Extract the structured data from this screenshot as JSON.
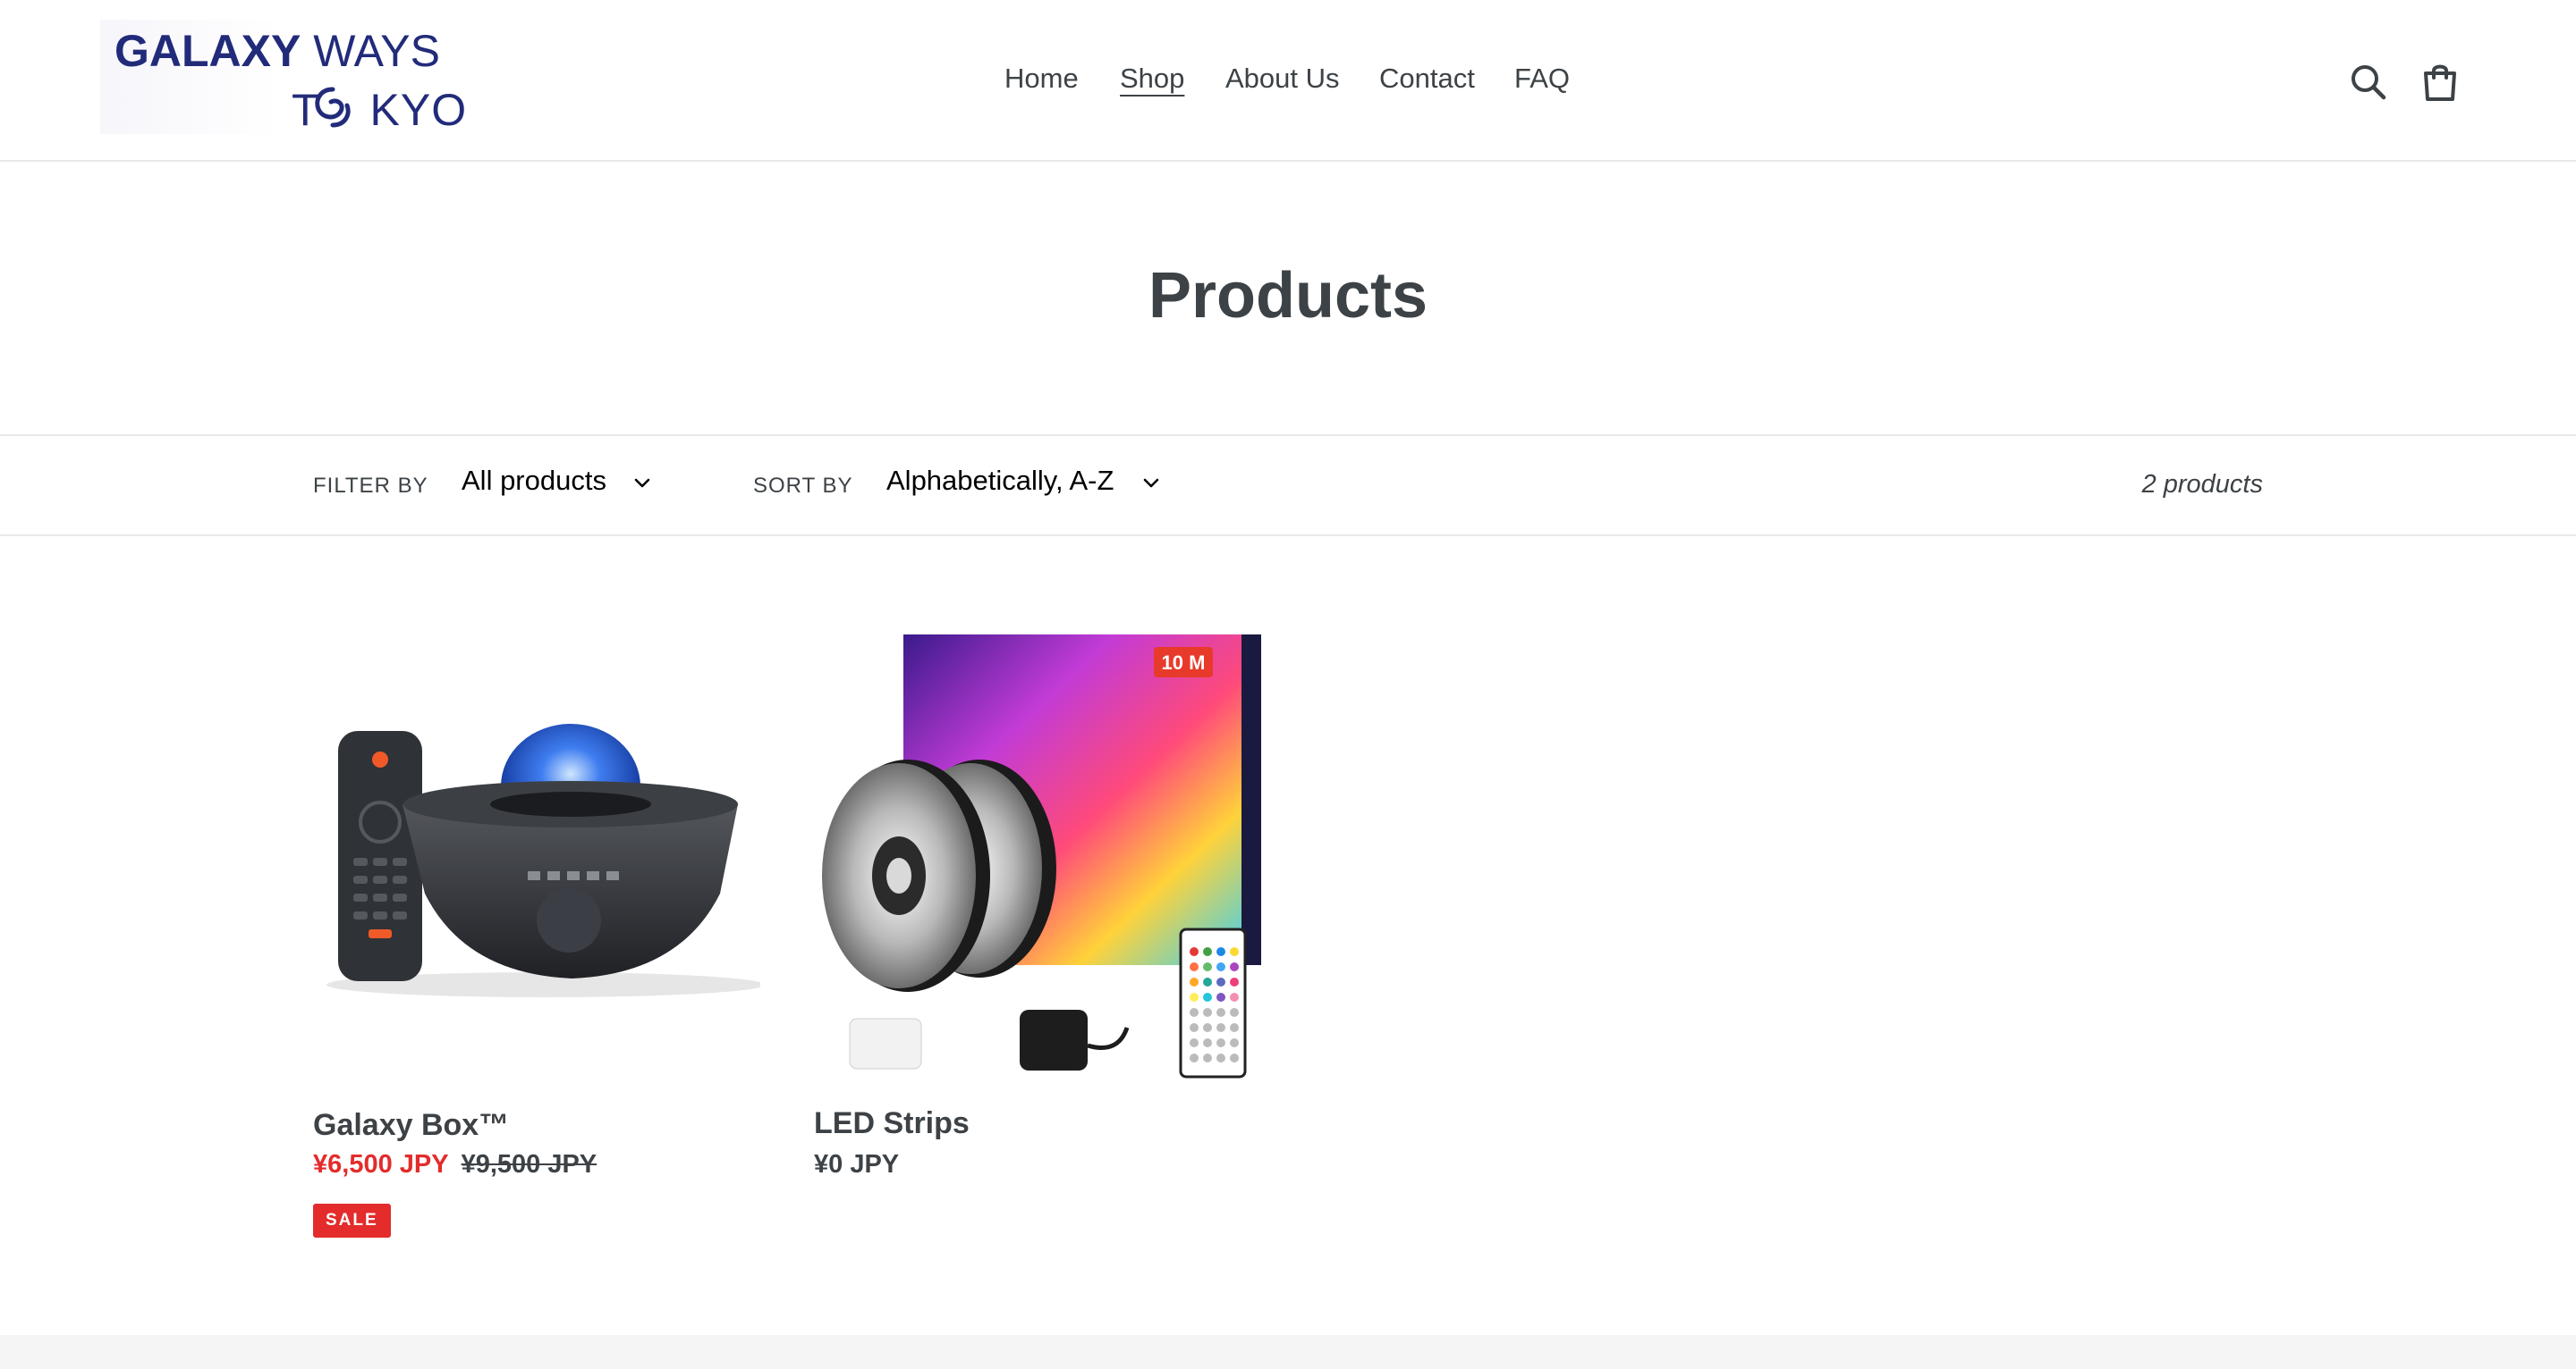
{
  "brand": {
    "logo_line1_bold": "GALAXY",
    "logo_line1_rest": "WAYS",
    "logo_line2_prefix": "T",
    "logo_line2_suffix": "KYO",
    "brand_color": "#222b7a"
  },
  "nav": {
    "items": [
      {
        "label": "Home"
      },
      {
        "label": "Shop",
        "active": true
      },
      {
        "label": "About Us"
      },
      {
        "label": "Contact"
      },
      {
        "label": "FAQ"
      }
    ]
  },
  "header_icons": [
    "search-icon",
    "cart-icon"
  ],
  "page": {
    "title": "Products"
  },
  "filter_bar": {
    "filter_label": "FILTER BY",
    "filter_value": "All products",
    "sort_label": "SORT BY",
    "sort_value": "Alphabetically, A-Z",
    "product_count": "2 products"
  },
  "products": [
    {
      "name": "Galaxy Box™",
      "sale_price": "¥6,500 JPY",
      "original_price": "¥9,500 JPY",
      "badge": "SALE"
    },
    {
      "name": "LED Strips",
      "price": "¥0 JPY"
    }
  ],
  "colors": {
    "text": "#3d4246",
    "sale": "#e32c2b",
    "border": "#e8e9eb"
  }
}
